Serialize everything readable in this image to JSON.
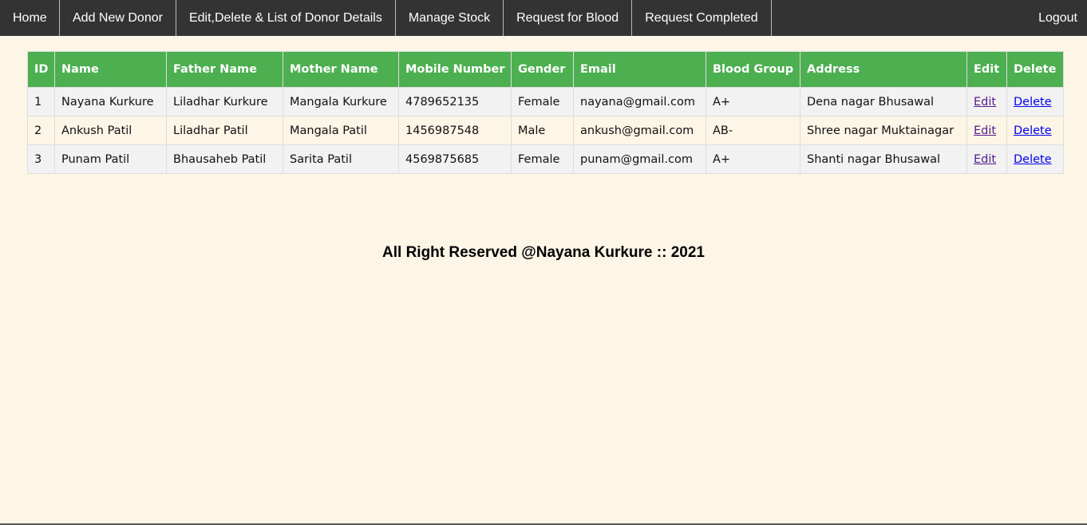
{
  "nav": {
    "items": [
      "Home",
      "Add New Donor",
      "Edit,Delete & List of Donor Details",
      "Manage Stock",
      "Request for Blood",
      "Request Completed"
    ],
    "logout": "Logout"
  },
  "table": {
    "headers": [
      "ID",
      "Name",
      "Father Name",
      "Mother Name",
      "Mobile Number",
      "Gender",
      "Email",
      "Blood Group",
      "Address",
      "Edit",
      "Delete"
    ],
    "rows": [
      {
        "id": "1",
        "name": "Nayana Kurkure",
        "father": "Liladhar Kurkure",
        "mother": "Mangala Kurkure",
        "mobile": "4789652135",
        "gender": "Female",
        "email": "nayana@gmail.com",
        "blood": "A+",
        "address": "Dena nagar Bhusawal",
        "edit": "Edit",
        "delete": "Delete"
      },
      {
        "id": "2",
        "name": "Ankush Patil",
        "father": "Liladhar Patil",
        "mother": "Mangala Patil",
        "mobile": "1456987548",
        "gender": "Male",
        "email": "ankush@gmail.com",
        "blood": "AB-",
        "address": "Shree nagar Muktainagar",
        "edit": "Edit",
        "delete": "Delete"
      },
      {
        "id": "3",
        "name": "Punam Patil",
        "father": "Bhausaheb Patil",
        "mother": "Sarita Patil",
        "mobile": "4569875685",
        "gender": "Female",
        "email": "punam@gmail.com",
        "blood": "A+",
        "address": "Shanti nagar Bhusawal",
        "edit": "Edit",
        "delete": "Delete"
      }
    ]
  },
  "footer": {
    "text": "All Right Reserved @Nayana Kurkure :: 2021"
  },
  "colors": {
    "nav_bg": "#333333",
    "header_bg": "#4caf50",
    "page_bg": "#fdf5e6",
    "row_alt": "#f2f2f2"
  }
}
